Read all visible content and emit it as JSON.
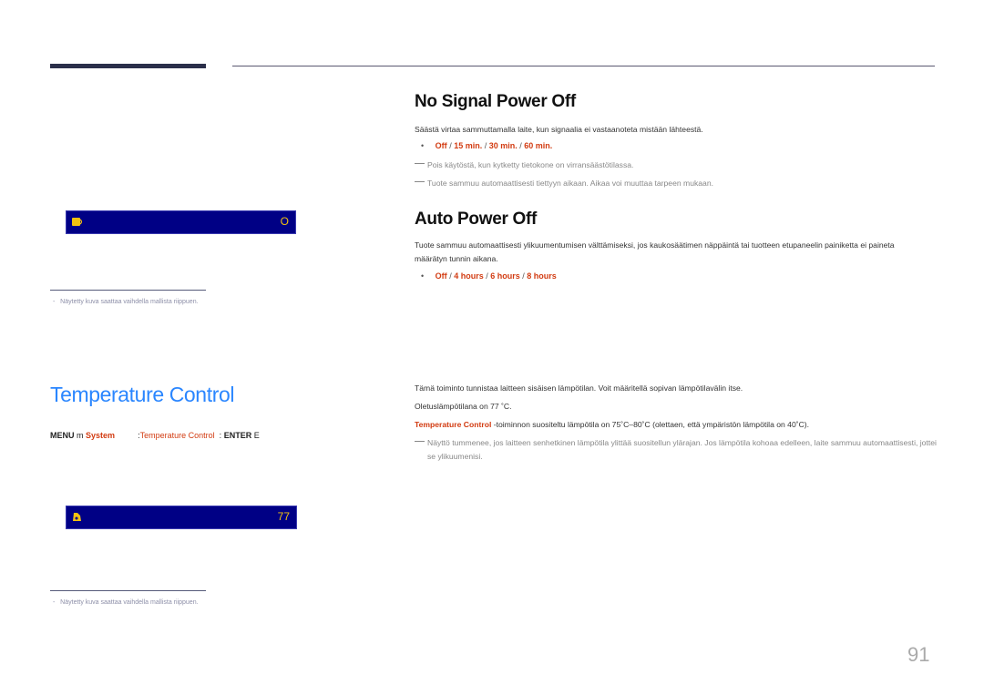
{
  "header": {
    "rule": "top-rule"
  },
  "no_signal": {
    "title": "No Signal Power Off",
    "description": "Säästä virtaa sammuttamalla laite, kun signaalia ei vastaanoteta mistään lähteestä.",
    "options": [
      "Off",
      "15 min.",
      "30 min.",
      "60 min."
    ],
    "separator": " / ",
    "notes": [
      "Pois käytöstä, kun kytketty tietokone on virransäästötilassa.",
      "Tuote sammuu automaattisesti tiettyyn aikaan. Aikaa voi muuttaa tarpeen mukaan."
    ]
  },
  "auto_power": {
    "title": "Auto Power Off",
    "description": "Tuote sammuu automaattisesti ylikuumentumisen välttämiseksi, jos kaukosäätimen näppäintä tai tuotteen etupaneelin painiketta ei paineta määrätyn tunnin aikana.",
    "options": [
      "Off",
      "4 hours",
      "6 hours",
      "8 hours"
    ]
  },
  "osd1": {
    "icon": "power-plug-icon",
    "value": "O",
    "bg": "#000085",
    "fg": "#f2c10f"
  },
  "footnote1": "Näytetty kuva saattaa vaihdella mallista riippuen.",
  "temperature": {
    "title": "Temperature Control",
    "menu_path": {
      "menu": "MENU",
      "menu_glyph": "m",
      "system": "System",
      "sep1": ":",
      "item": "Temperature Control",
      "sep2": ":",
      "enter": "ENTER",
      "enter_glyph": "E"
    },
    "desc1": "Tämä toiminto tunnistaa laitteen sisäisen lämpötilan. Voit määritellä sopivan lämpötilavälin itse.",
    "desc2": "Oletuslämpötilana on 77 ˚C.",
    "desc3_label": "Temperature Control",
    "desc3_text": " -toiminnon suositeltu lämpötila on 75˚C–80˚C (olettaen, että ympäristön lämpötila on 40˚C).",
    "note": "Näyttö tummenee, jos laitteen senhetkinen lämpötila ylittää suositellun ylärajan. Jos lämpötila kohoaa edelleen, laite sammuu automaattisesti, jottei se ylikuumenisi."
  },
  "osd2": {
    "icon": "thermometer-icon",
    "value": "77"
  },
  "footnote2": "Näytetty kuva saattaa vaihdella mallista riippuen.",
  "page_number": "91",
  "colors": {
    "accent_red": "#d23b11",
    "title_blue": "#2a86ff",
    "osd_bg": "#000085",
    "osd_fg": "#f2c10f"
  }
}
